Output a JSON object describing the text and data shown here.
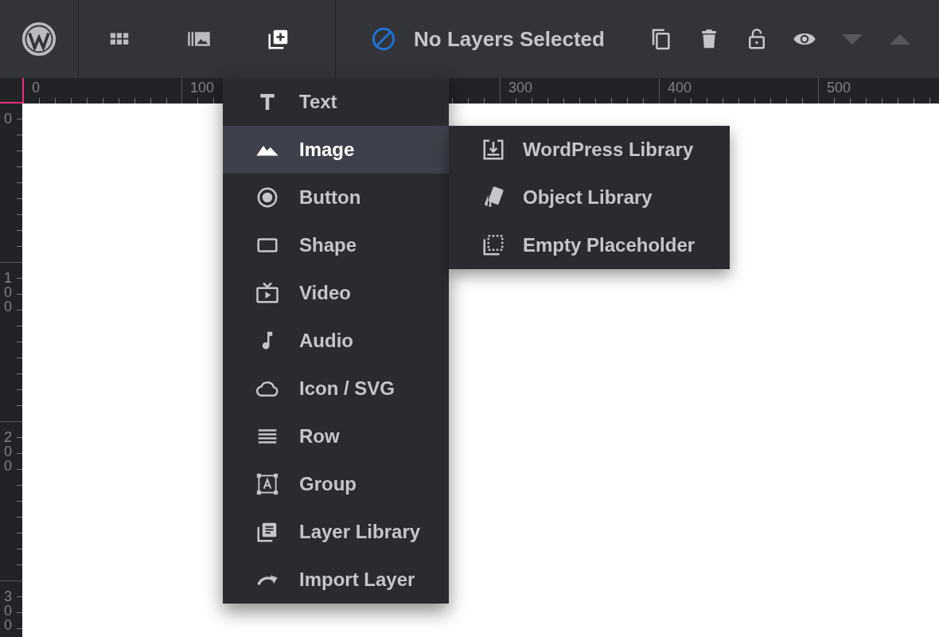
{
  "toolbar": {
    "tools": [
      {
        "kind": "grid",
        "selected": false
      },
      {
        "kind": "media",
        "selected": false
      },
      {
        "kind": "add",
        "selected": true
      }
    ],
    "status": "No Layers Selected",
    "actions": [
      {
        "kind": "duplicate",
        "disabled": false
      },
      {
        "kind": "delete",
        "disabled": false
      },
      {
        "kind": "lock",
        "disabled": false
      },
      {
        "kind": "visibility",
        "disabled": false
      },
      {
        "kind": "move-down",
        "disabled": true
      },
      {
        "kind": "move-up",
        "disabled": true
      }
    ]
  },
  "rulers": {
    "horizontal": [
      {
        "kind": "labeled",
        "label": "0"
      },
      {
        "kind": "labeled",
        "label": "100"
      },
      {
        "kind": "blank"
      },
      {
        "kind": "labeled",
        "label": "300"
      },
      {
        "kind": "labeled",
        "label": "400"
      },
      {
        "kind": "labeled",
        "label": "500"
      }
    ],
    "vertical": [
      "0",
      "100",
      "200",
      "300"
    ]
  },
  "add_menu": {
    "items": [
      {
        "kind": "text",
        "label": "Text",
        "selected": false
      },
      {
        "kind": "image",
        "label": "Image",
        "selected": true
      },
      {
        "kind": "button",
        "label": "Button",
        "selected": false
      },
      {
        "kind": "shape",
        "label": "Shape",
        "selected": false
      },
      {
        "kind": "video",
        "label": "Video",
        "selected": false
      },
      {
        "kind": "audio",
        "label": "Audio",
        "selected": false
      },
      {
        "kind": "icon",
        "label": "Icon / SVG",
        "selected": false
      },
      {
        "kind": "row",
        "label": "Row",
        "selected": false
      },
      {
        "kind": "group",
        "label": "Group",
        "selected": false
      },
      {
        "kind": "library",
        "label": "Layer Library",
        "selected": false
      },
      {
        "kind": "import",
        "label": "Import Layer",
        "selected": false
      }
    ]
  },
  "image_submenu": {
    "items": [
      {
        "kind": "download",
        "label": "WordPress Library",
        "selected": false
      },
      {
        "kind": "objects",
        "label": "Object Library",
        "selected": false
      },
      {
        "kind": "placeholder",
        "label": "Empty Placeholder",
        "selected": false
      }
    ]
  }
}
